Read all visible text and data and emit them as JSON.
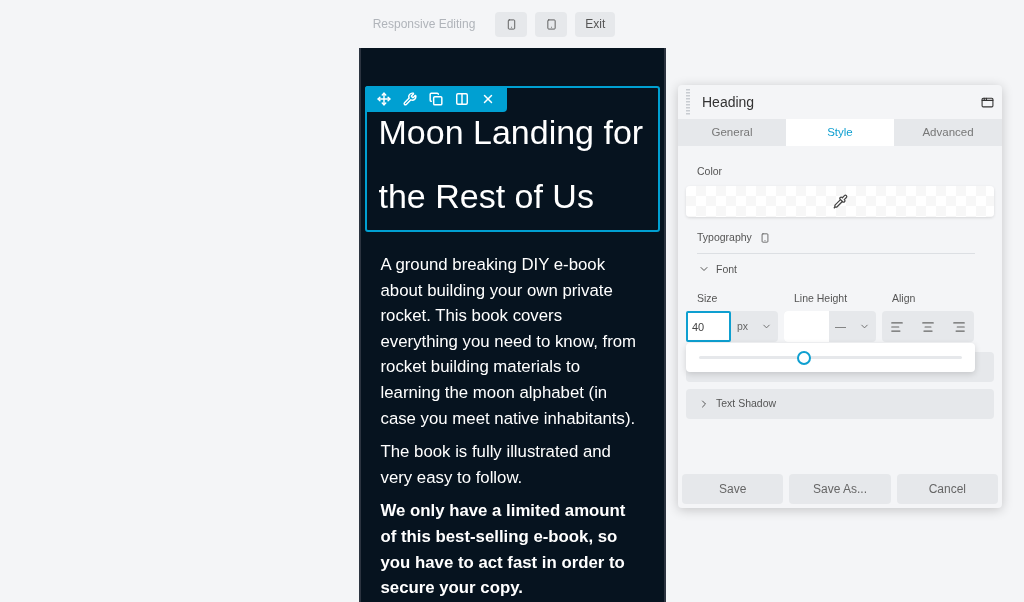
{
  "topbar": {
    "label": "Responsive Editing",
    "device_buttons": [
      {
        "kind": "phone"
      },
      {
        "kind": "tablet"
      }
    ],
    "exit": "Exit"
  },
  "preview": {
    "toolbar": [
      {
        "kind": "move"
      },
      {
        "kind": "settings"
      },
      {
        "kind": "duplicate"
      },
      {
        "kind": "columns"
      },
      {
        "kind": "close"
      }
    ],
    "heading": "Moon Landing for the Rest of Us",
    "paragraphs": [
      {
        "text": "A ground breaking DIY e-book about building your own private rocket. This book covers everything you need to know, from rocket building materials to learning the moon alphabet (in case you meet native inhabitants).",
        "bold": false
      },
      {
        "text": "The book is fully illustrated and very easy to follow.",
        "bold": false
      },
      {
        "text": "We only have a limited amount of this best-selling e-book, so you have to act fast in order to secure your copy.",
        "bold": true
      }
    ]
  },
  "panel": {
    "title": "Heading",
    "tabs": [
      {
        "label": "General",
        "selected": false
      },
      {
        "label": "Style",
        "selected": true
      },
      {
        "label": "Advanced",
        "selected": false
      }
    ],
    "color_label": "Color",
    "typography_label": "Typography",
    "font_section": {
      "label": "Font",
      "expanded": true
    },
    "size": {
      "label": "Size",
      "value": "40",
      "unit": "px",
      "level": 0.4
    },
    "line_height": {
      "label": "Line Height",
      "unit": "—"
    },
    "align": {
      "label": "Align",
      "options": [
        {
          "kind": "left"
        },
        {
          "kind": "center"
        },
        {
          "kind": "right"
        }
      ]
    },
    "sections": [
      {
        "label": "Text Shadow",
        "expanded": false
      }
    ],
    "buttons": [
      "Save",
      "Save As...",
      "Cancel"
    ]
  }
}
